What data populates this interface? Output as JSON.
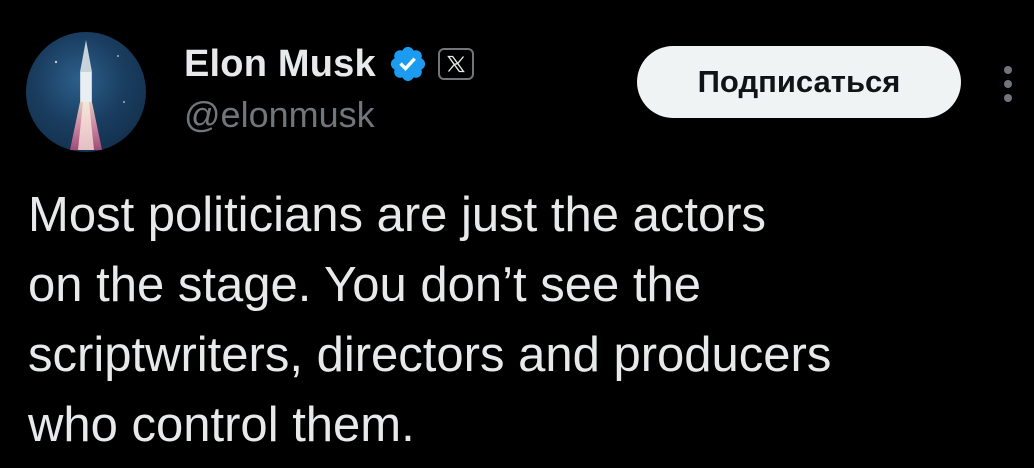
{
  "author": {
    "display_name": "Elon Musk",
    "handle": "@elonmusk",
    "avatar_icon": "rocket-launch-avatar",
    "verified_icon": "verified-badge-icon",
    "affiliation_icon": "x-logo-icon"
  },
  "actions": {
    "follow_label": "Подписаться",
    "more_icon": "more-vertical-icon"
  },
  "tweet": {
    "lines": [
      "Most politicians are just the actors",
      "on the stage. You don’t see the",
      "scriptwriters, directors and producers",
      "who control them."
    ]
  },
  "colors": {
    "background": "#000000",
    "text_primary": "#e7e9ea",
    "text_secondary": "#71767b",
    "verified_blue": "#1d9bf0",
    "button_bg": "#eff3f4",
    "button_text": "#0f1419"
  }
}
